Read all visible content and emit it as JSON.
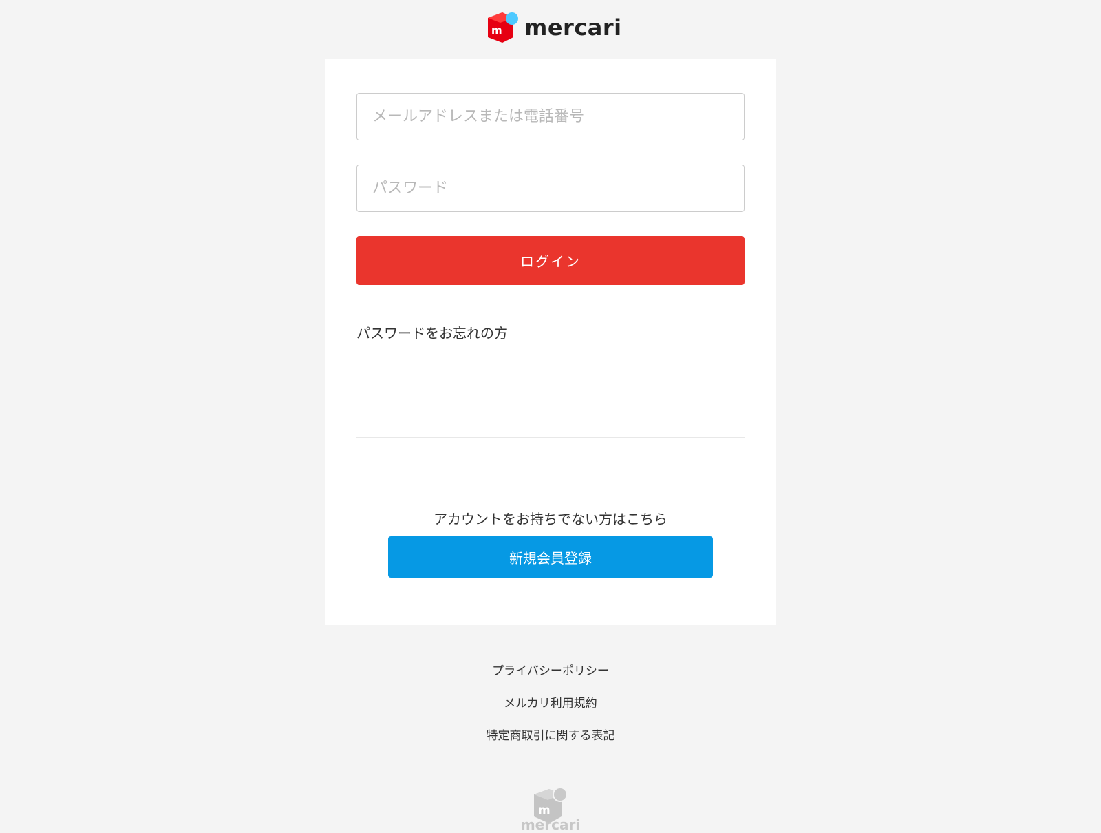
{
  "header": {
    "logo_text": "mercari",
    "logo_icon": "mercari-logo-icon"
  },
  "login_form": {
    "email_placeholder": "メールアドレスまたは電話番号",
    "password_placeholder": "パスワード",
    "login_label": "ログイン",
    "forgot_password_label": "パスワードをお忘れの方"
  },
  "signup": {
    "prompt": "アカウントをお持ちでない方はこちら",
    "button_label": "新規会員登録"
  },
  "footer": {
    "links": [
      "プライバシーポリシー",
      "メルカリ利用規約",
      "特定商取引に関する表記"
    ],
    "logo_text": "mercari"
  },
  "colors": {
    "background": "#f4f4f4",
    "card": "#ffffff",
    "login_button": "#ea352d",
    "signup_button": "#0699e4",
    "logo_red": "#e60012",
    "logo_blue": "#4dc9ff"
  }
}
